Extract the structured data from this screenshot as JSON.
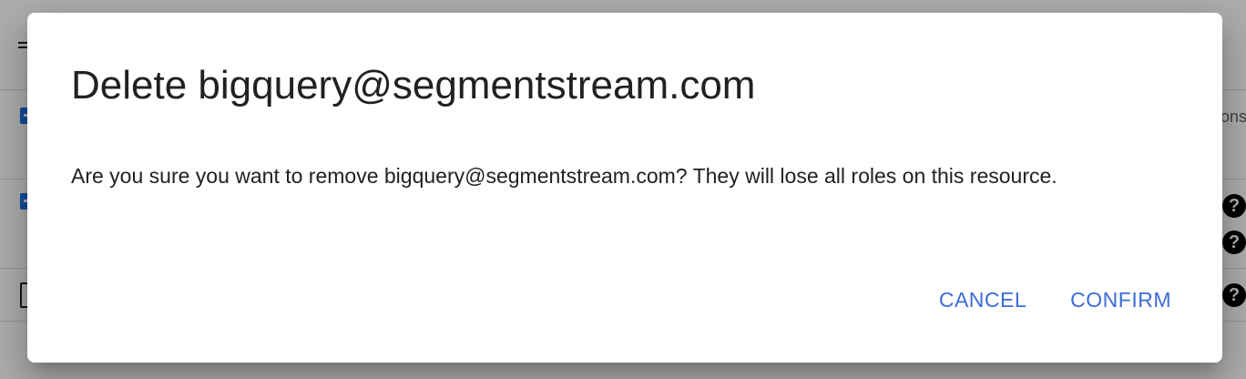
{
  "background": {
    "clipped_text": "ons",
    "help_icon_glyph": "?"
  },
  "dialog": {
    "title": "Delete bigquery@segmentstream.com",
    "message": "Are you sure you want to remove bigquery@segmentstream.com? They will lose all roles on this resource.",
    "cancel_label": "CANCEL",
    "confirm_label": "CONFIRM",
    "accent_color": "#3c6cd8"
  }
}
